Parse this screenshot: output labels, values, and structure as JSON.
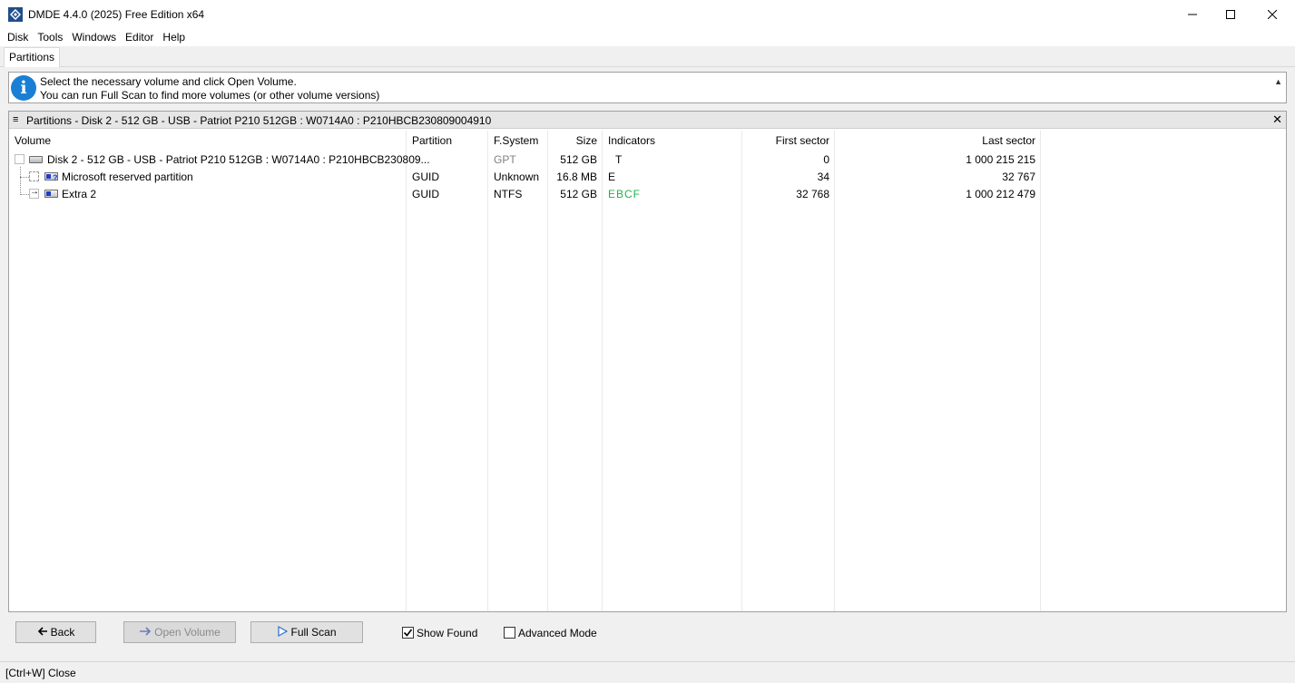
{
  "window": {
    "title": "DMDE 4.4.0 (2025) Free Edition x64",
    "minimize_glyph": "—",
    "maximize_glyph": "☐",
    "close_glyph": "✕"
  },
  "menu": [
    "Disk",
    "Tools",
    "Windows",
    "Editor",
    "Help"
  ],
  "tabs": [
    {
      "label": "Partitions",
      "active": true
    }
  ],
  "info": {
    "icon": "info-icon",
    "glyph": "i",
    "line1": "Select the necessary volume and click Open Volume.",
    "line2": "You can run Full Scan to find more volumes (or other volume versions)",
    "collapse_glyph": "▲"
  },
  "panel": {
    "menu_glyph": "≡",
    "title": "Partitions - Disk 2 - 512 GB - USB - Patriot P210 512GB : W0714A0 : P210HBCB230809004910",
    "close_glyph": "✕"
  },
  "table": {
    "columns": [
      "Volume",
      "Partition",
      "F.System",
      "Size",
      "Indicators",
      "First sector",
      "Last sector"
    ],
    "rows": [
      {
        "volume": "Disk 2 - 512 GB - USB - Patriot P210 512GB : W0714A0 : P210HBCB230809...",
        "partition": "",
        "fs": "GPT",
        "size": "512 GB",
        "indicators": "T",
        "first": "0",
        "last": "1 000 215 215",
        "icon": "drive-icon"
      },
      {
        "volume": "Microsoft reserved partition",
        "partition": "GUID",
        "fs": "Unknown",
        "size": "16.8 MB",
        "indicators": "E",
        "first": "34",
        "last": "32 767",
        "icon": "partition-unknown-icon"
      },
      {
        "volume": "Extra 2",
        "partition": "GUID",
        "fs": "NTFS",
        "size": "512 GB",
        "indicators": "EBCF",
        "first": "32 768",
        "last": "1 000 212 479",
        "icon": "partition-ntfs-icon"
      }
    ],
    "colors": {
      "indicator_ok": "#22b14c",
      "muted": "#808080"
    }
  },
  "buttons": {
    "back": "Back",
    "open_volume": "Open Volume",
    "full_scan": "Full Scan"
  },
  "options": {
    "show_found": {
      "label": "Show Found",
      "checked": true
    },
    "advanced_mode": {
      "label": "Advanced Mode",
      "checked": false
    }
  },
  "status": "[Ctrl+W] Close"
}
